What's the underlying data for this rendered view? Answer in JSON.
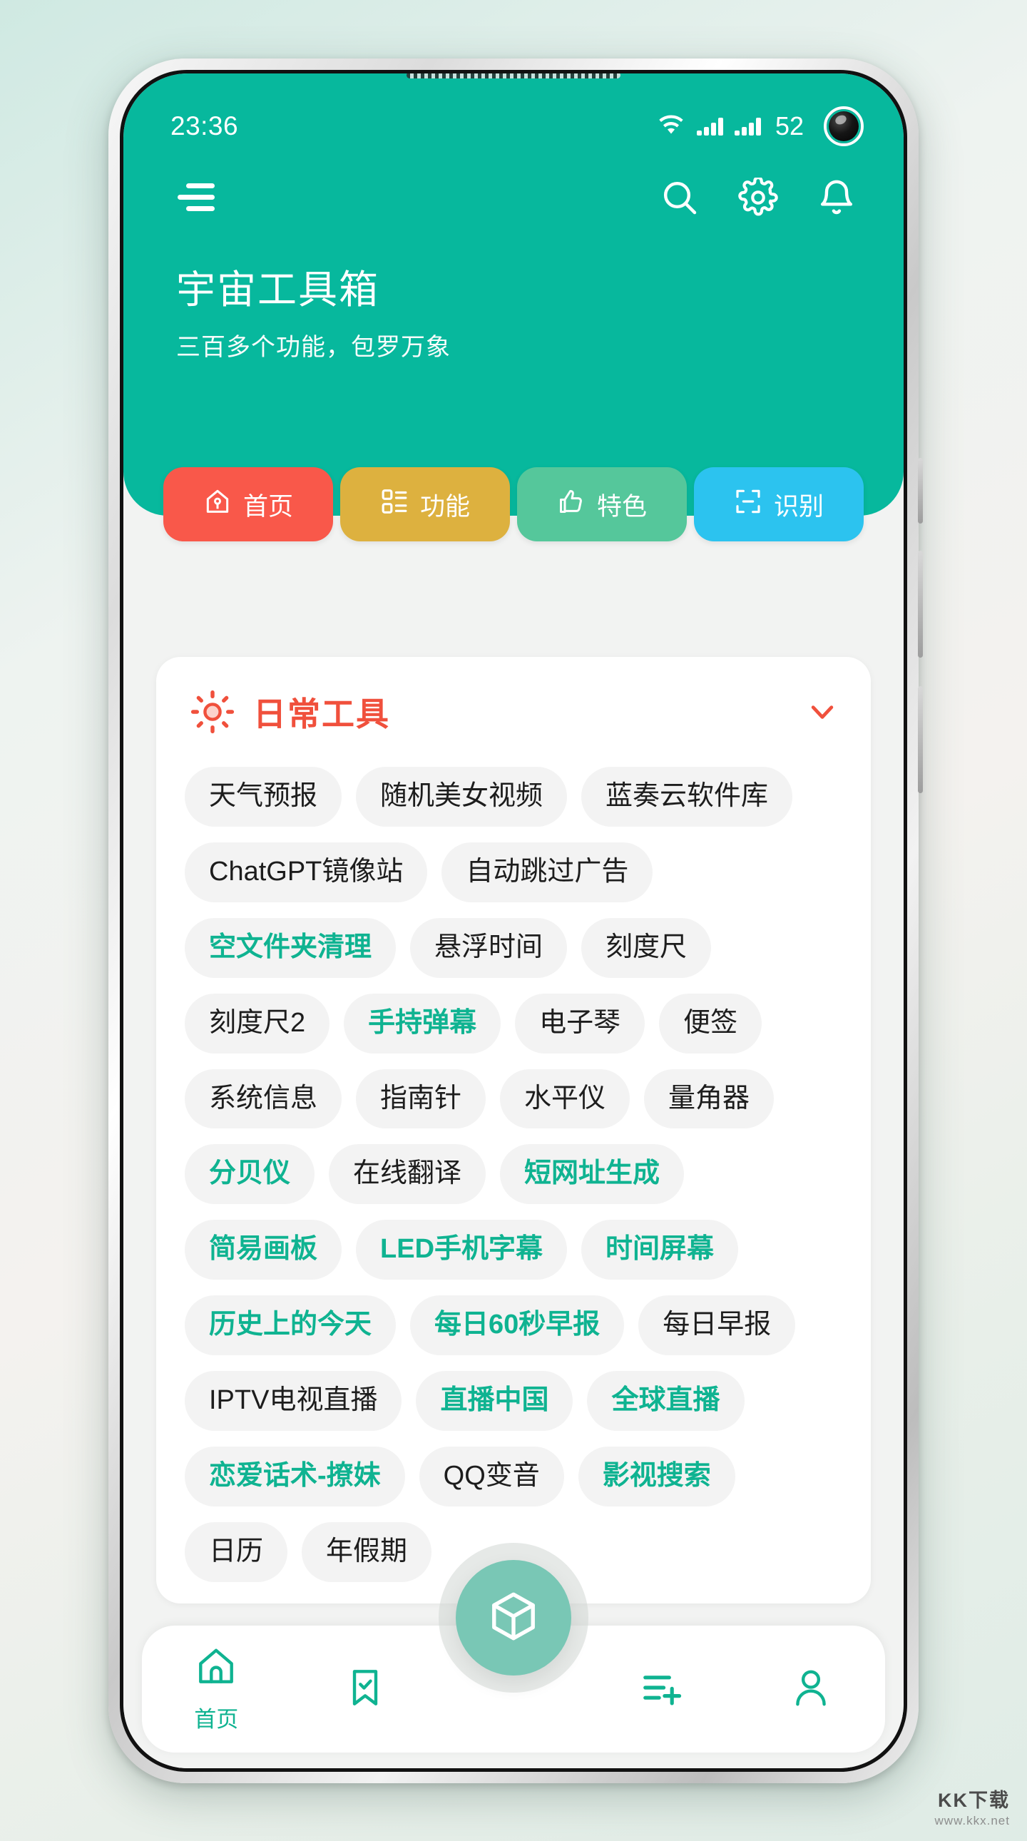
{
  "status_bar": {
    "time": "23:36",
    "battery": "52",
    "wifi_icon": "wifi-icon",
    "signal_icon": "signal-bars-icon",
    "camera_icon": "front-camera-punch-hole"
  },
  "header": {
    "menu_icon": "hamburger-menu-icon",
    "search_icon": "search-icon",
    "settings_icon": "gear-icon",
    "notification_icon": "bell-icon",
    "title": "宇宙工具箱",
    "subtitle": "三百多个功能，包罗万象",
    "background_color": "#07b89d"
  },
  "category_tabs": [
    {
      "label": "首页",
      "icon": "home-icon",
      "color": "#f9584a"
    },
    {
      "label": "功能",
      "icon": "grid-icon",
      "color": "#ddb13f"
    },
    {
      "label": "特色",
      "icon": "thumbs-up-icon",
      "color": "#55c79b"
    },
    {
      "label": "识别",
      "icon": "scan-icon",
      "color": "#2cc3ef"
    }
  ],
  "tool_card": {
    "icon": "sun-icon",
    "title": "日常工具",
    "title_color": "#f0503c",
    "collapse_icon": "chevron-down-icon",
    "accent_color": "#0fb391",
    "chips": [
      {
        "label": "天气预报",
        "accent": false
      },
      {
        "label": "随机美女视频",
        "accent": false
      },
      {
        "label": "蓝奏云软件库",
        "accent": false
      },
      {
        "label": "ChatGPT镜像站",
        "accent": false
      },
      {
        "label": "自动跳过广告",
        "accent": false
      },
      {
        "label": "空文件夹清理",
        "accent": true
      },
      {
        "label": "悬浮时间",
        "accent": false
      },
      {
        "label": "刻度尺",
        "accent": false
      },
      {
        "label": "刻度尺2",
        "accent": false
      },
      {
        "label": "手持弹幕",
        "accent": true
      },
      {
        "label": "电子琴",
        "accent": false
      },
      {
        "label": "便签",
        "accent": false
      },
      {
        "label": "系统信息",
        "accent": false
      },
      {
        "label": "指南针",
        "accent": false
      },
      {
        "label": "水平仪",
        "accent": false
      },
      {
        "label": "量角器",
        "accent": false
      },
      {
        "label": "分贝仪",
        "accent": true
      },
      {
        "label": "在线翻译",
        "accent": false
      },
      {
        "label": "短网址生成",
        "accent": true
      },
      {
        "label": "简易画板",
        "accent": true
      },
      {
        "label": "LED手机字幕",
        "accent": true
      },
      {
        "label": "时间屏幕",
        "accent": true
      },
      {
        "label": "历史上的今天",
        "accent": true
      },
      {
        "label": "每日60秒早报",
        "accent": true
      },
      {
        "label": "每日早报",
        "accent": false
      },
      {
        "label": "IPTV电视直播",
        "accent": false
      },
      {
        "label": "直播中国",
        "accent": true
      },
      {
        "label": "全球直播",
        "accent": true
      },
      {
        "label": "恋爱话术-撩妹",
        "accent": true
      },
      {
        "label": "QQ变音",
        "accent": false
      },
      {
        "label": "影视搜索",
        "accent": true
      },
      {
        "label": "日历",
        "accent": false
      },
      {
        "label": "年假期",
        "accent": false
      }
    ]
  },
  "bottom_nav": {
    "items": [
      {
        "label": "首页",
        "icon": "home-outline-icon"
      },
      {
        "label": "",
        "icon": "bookmark-check-icon"
      },
      {
        "label": "",
        "icon": "list-add-icon"
      },
      {
        "label": "",
        "icon": "person-icon"
      }
    ],
    "fab_icon": "cube-icon",
    "active_color": "#0fb391"
  },
  "watermark": {
    "main": "KK下载",
    "sub": "www.kkx.net"
  }
}
